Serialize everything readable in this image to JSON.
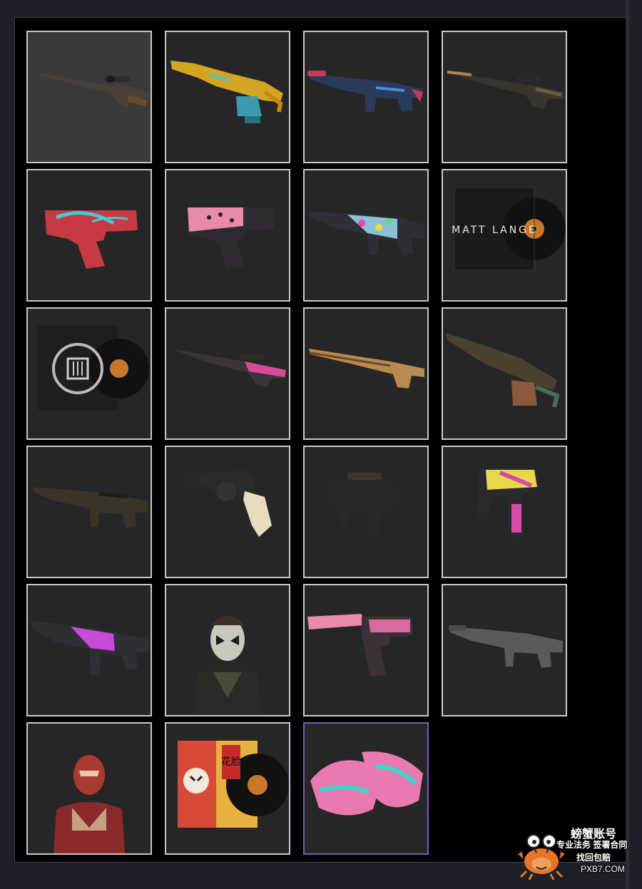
{
  "colors": {
    "page_bg": "#1c2128",
    "panel_bg": "#000000",
    "slot_bg": "#262626",
    "slot_border": "#c8c8c8",
    "selected_slot_bg": "#3a3a3a",
    "rare_border": "#7d5bb0"
  },
  "inventory": {
    "items": [
      {
        "icon": "sniper-rifle-icon",
        "selected": true
      },
      {
        "icon": "machine-gun-yellow-icon"
      },
      {
        "icon": "assault-rifle-blue-icon"
      },
      {
        "icon": "sniper-rifle-tan-icon"
      },
      {
        "icon": "pistol-red-icon"
      },
      {
        "icon": "desert-eagle-pink-icon"
      },
      {
        "icon": "assault-rifle-graffiti-icon"
      },
      {
        "icon": "music-kit-icon",
        "label": "MATT LANGE"
      },
      {
        "icon": "music-kit-emblem-icon"
      },
      {
        "icon": "sniper-rifle-pink-icon"
      },
      {
        "icon": "shotgun-tan-icon"
      },
      {
        "icon": "machine-gun-dark-icon"
      },
      {
        "icon": "carbine-dark-icon"
      },
      {
        "icon": "revolver-icon"
      },
      {
        "icon": "smg-dark-icon"
      },
      {
        "icon": "machine-pistol-pink-icon"
      },
      {
        "icon": "assault-rifle-pink-icon"
      },
      {
        "icon": "agent-masked-icon"
      },
      {
        "icon": "suppressed-pistol-icon"
      },
      {
        "icon": "carbine-grey-icon"
      },
      {
        "icon": "agent-red-icon"
      },
      {
        "icon": "music-kit-opera-icon",
        "label": "花脸"
      },
      {
        "icon": "gloves-icon",
        "rare": true
      }
    ]
  },
  "watermark": {
    "brand": "螃蟹账号",
    "slogan1": "专业法务 签署合同",
    "slogan2": "找回包赔",
    "site": "PXB7.COM"
  }
}
